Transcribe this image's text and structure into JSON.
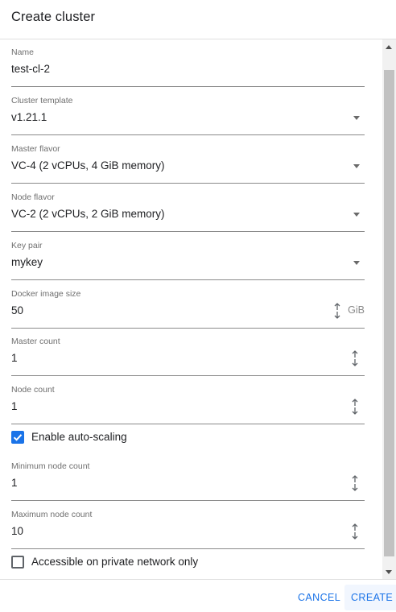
{
  "dialog": {
    "title": "Create cluster"
  },
  "fields": {
    "name": {
      "label": "Name",
      "value": "test-cl-2"
    },
    "cluster_template": {
      "label": "Cluster template",
      "value": "v1.21.1"
    },
    "master_flavor": {
      "label": "Master flavor",
      "value": "VC-4 (2 vCPUs, 4 GiB memory)"
    },
    "node_flavor": {
      "label": "Node flavor",
      "value": "VC-2 (2 vCPUs, 2 GiB memory)"
    },
    "key_pair": {
      "label": "Key pair",
      "value": "mykey"
    },
    "docker_image_size": {
      "label": "Docker image size",
      "value": "50",
      "unit": "GiB"
    },
    "master_count": {
      "label": "Master count",
      "value": "1"
    },
    "node_count": {
      "label": "Node count",
      "value": "1"
    },
    "min_node_count": {
      "label": "Minimum node count",
      "value": "1"
    },
    "max_node_count": {
      "label": "Maximum node count",
      "value": "10"
    }
  },
  "checkboxes": {
    "auto_scaling": {
      "label": "Enable auto-scaling",
      "checked": true
    },
    "private_network": {
      "label": "Accessible on private network only",
      "checked": false
    }
  },
  "footer": {
    "cancel_label": "CANCEL",
    "create_label": "CREATE"
  },
  "colors": {
    "accent": "#1a73e8",
    "label": "#6f6f6f",
    "text": "#202124"
  },
  "icons": {
    "dropdown": "caret-down-icon",
    "spinner": "up-down-arrows-icon",
    "check": "checkmark-icon"
  }
}
